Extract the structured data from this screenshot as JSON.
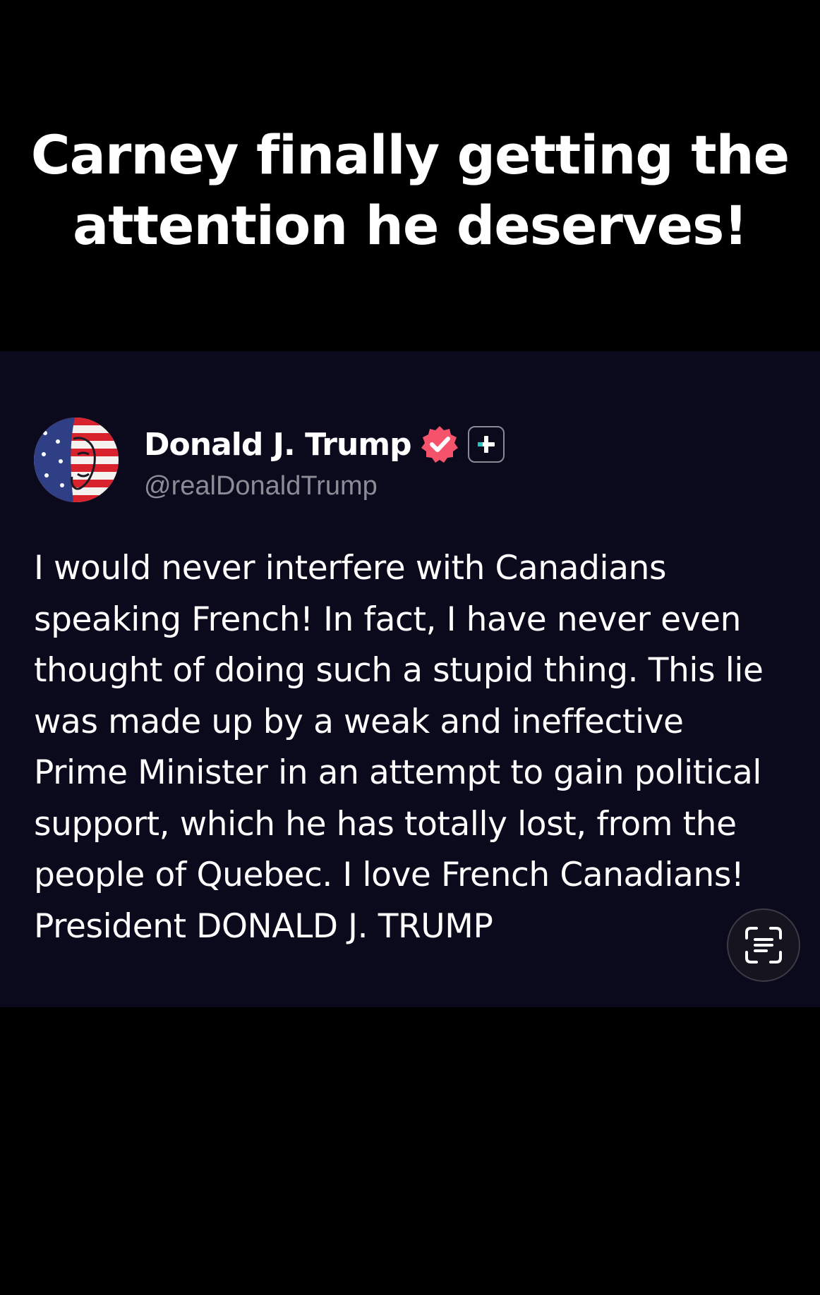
{
  "caption": {
    "line1": "Carney finally getting the",
    "line2": "attention he deserves!"
  },
  "post": {
    "author": {
      "name": "Donald J. Trump",
      "handle": "@realDonaldTrump",
      "avatar": "american-flag-portrait-avatar",
      "verified_badge": "verified-checkmark-icon",
      "verified_color": "#f5536b",
      "extra_badge": "plus-icon",
      "extra_badge_accent": "#21c6c0"
    },
    "body_lines": [
      "I would never interfere with Canadians",
      "speaking French! In fact, I have never even",
      "thought of doing such a stupid thing. This lie",
      "was made up by a weak and ineffective",
      "Prime Minister in an attempt to gain political",
      "support, which he has totally lost, from the",
      "people of Quebec. I love French Canadians!",
      "President DONALD J. TRUMP"
    ]
  },
  "scan_button": {
    "icon": "scan-text-icon"
  },
  "colors": {
    "page_background": "#000000",
    "card_background": "#0b0a1c",
    "text_primary": "#ffffff",
    "text_secondary": "#8c8c96"
  }
}
